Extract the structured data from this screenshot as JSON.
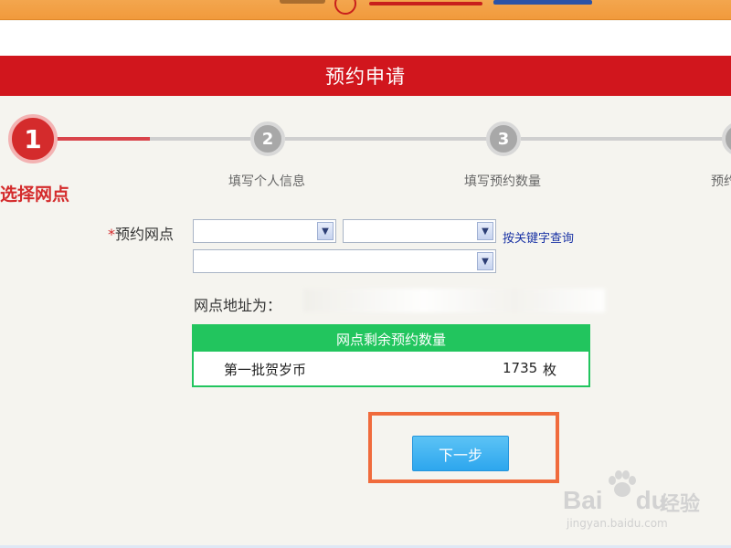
{
  "header": {
    "title": "预约申请"
  },
  "steps": [
    {
      "number": "1",
      "label": "选择网点",
      "active": true
    },
    {
      "number": "2",
      "label": "填写个人信息",
      "active": false
    },
    {
      "number": "3",
      "label": "填写预约数量",
      "active": false
    },
    {
      "number": "",
      "label": "预约",
      "active": false
    }
  ],
  "form": {
    "required_mark": "*",
    "branch_label": "预约网点",
    "select1_value": "",
    "select2_value": "",
    "select3_value": "",
    "keyword_search_link": "按关键字查询",
    "address_label": "网点地址为："
  },
  "quantity_table": {
    "header": "网点剩余预约数量",
    "rows": [
      {
        "name": "第一批贺岁币",
        "count": "1735",
        "unit": "枚"
      }
    ]
  },
  "actions": {
    "next_label": "下一步"
  },
  "watermark": {
    "brand": "Bai",
    "brand_suffix": "du",
    "product": "经验",
    "url": "jingyan.baidu.com"
  },
  "colors": {
    "primary_red": "#d1161d",
    "table_green": "#22c55e",
    "button_blue": "#2da6ee",
    "highlight_orange": "#f06b3c"
  }
}
